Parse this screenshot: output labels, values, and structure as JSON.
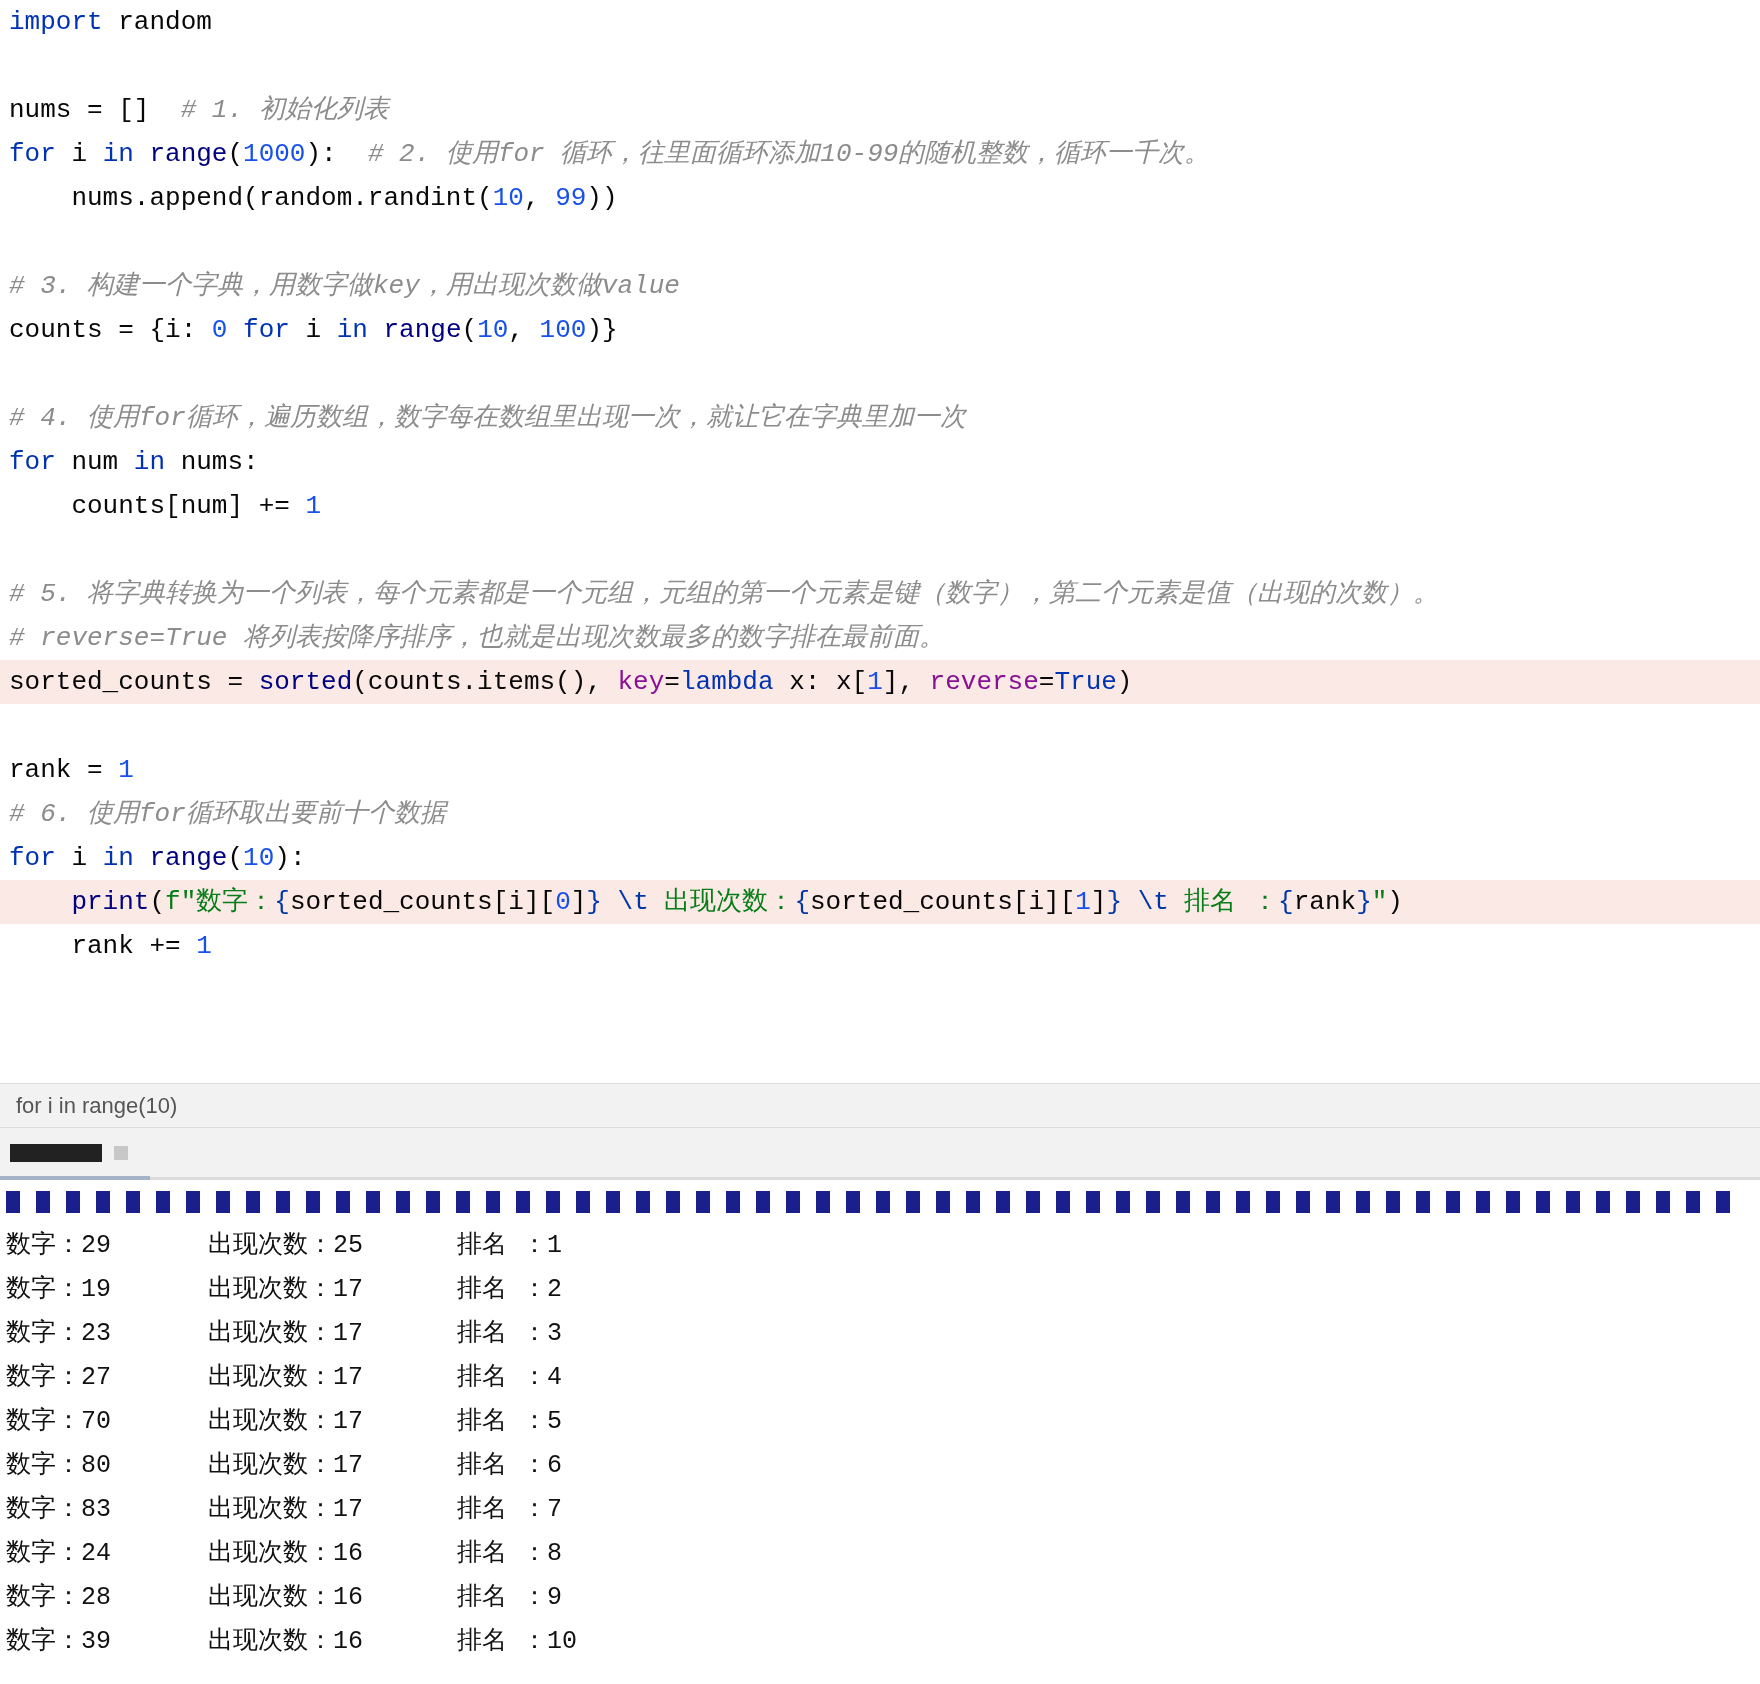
{
  "editor": {
    "lines": [
      {
        "kind": "code",
        "highlighted": false,
        "tokens": [
          {
            "kind": "kw",
            "text": "import"
          },
          {
            "kind": "plain",
            "text": " random"
          }
        ]
      },
      {
        "kind": "blank",
        "highlighted": false
      },
      {
        "kind": "code",
        "highlighted": false,
        "tokens": [
          {
            "kind": "plain",
            "text": "nums = []  "
          },
          {
            "kind": "comment",
            "text": "# 1. 初始化列表"
          }
        ]
      },
      {
        "kind": "code",
        "highlighted": false,
        "tokens": [
          {
            "kind": "kw",
            "text": "for"
          },
          {
            "kind": "plain",
            "text": " i "
          },
          {
            "kind": "kw",
            "text": "in "
          },
          {
            "kind": "builtin",
            "text": "range"
          },
          {
            "kind": "plain",
            "text": "("
          },
          {
            "kind": "num",
            "text": "1000"
          },
          {
            "kind": "plain",
            "text": "):  "
          },
          {
            "kind": "comment",
            "text": "# 2. 使用for 循环，往里面循环添加10-99的随机整数，循环一千次。"
          }
        ]
      },
      {
        "kind": "code",
        "highlighted": false,
        "tokens": [
          {
            "kind": "plain",
            "text": "    nums.append(random.randint("
          },
          {
            "kind": "num",
            "text": "10"
          },
          {
            "kind": "plain",
            "text": ", "
          },
          {
            "kind": "num",
            "text": "99"
          },
          {
            "kind": "plain",
            "text": "))"
          }
        ]
      },
      {
        "kind": "blank",
        "highlighted": false
      },
      {
        "kind": "code",
        "highlighted": false,
        "tokens": [
          {
            "kind": "comment",
            "text": "# 3. 构建一个字典，用数字做key，用出现次数做value"
          }
        ]
      },
      {
        "kind": "code",
        "highlighted": false,
        "tokens": [
          {
            "kind": "plain",
            "text": "counts = {i: "
          },
          {
            "kind": "num",
            "text": "0"
          },
          {
            "kind": "kw",
            "text": " for"
          },
          {
            "kind": "plain",
            "text": " i "
          },
          {
            "kind": "kw",
            "text": "in "
          },
          {
            "kind": "builtin",
            "text": "range"
          },
          {
            "kind": "plain",
            "text": "("
          },
          {
            "kind": "num",
            "text": "10"
          },
          {
            "kind": "plain",
            "text": ", "
          },
          {
            "kind": "num",
            "text": "100"
          },
          {
            "kind": "plain",
            "text": ")}"
          }
        ]
      },
      {
        "kind": "blank",
        "highlighted": false
      },
      {
        "kind": "code",
        "highlighted": false,
        "tokens": [
          {
            "kind": "comment",
            "text": "# 4. 使用for循环，遍历数组，数字每在数组里出现一次，就让它在字典里加一次"
          }
        ]
      },
      {
        "kind": "code",
        "highlighted": false,
        "tokens": [
          {
            "kind": "kw",
            "text": "for"
          },
          {
            "kind": "plain",
            "text": " num "
          },
          {
            "kind": "kw",
            "text": "in"
          },
          {
            "kind": "plain",
            "text": " nums:"
          }
        ]
      },
      {
        "kind": "code",
        "highlighted": false,
        "tokens": [
          {
            "kind": "plain",
            "text": "    counts[num] += "
          },
          {
            "kind": "num",
            "text": "1"
          }
        ]
      },
      {
        "kind": "blank",
        "highlighted": false
      },
      {
        "kind": "code",
        "highlighted": false,
        "tokens": [
          {
            "kind": "comment",
            "text": "# 5. 将字典转换为一个列表，每个元素都是一个元组，元组的第一个元素是键（数字），第二个元素是值（出现的次数）。"
          }
        ]
      },
      {
        "kind": "code",
        "highlighted": false,
        "tokens": [
          {
            "kind": "comment",
            "text": "# reverse=True 将列表按降序排序，也就是出现次数最多的数字排在最前面。"
          }
        ]
      },
      {
        "kind": "code",
        "highlighted": true,
        "tokens": [
          {
            "kind": "plain",
            "text": "sorted_counts = "
          },
          {
            "kind": "builtin",
            "text": "sorted"
          },
          {
            "kind": "plain",
            "text": "(counts.items(), "
          },
          {
            "kind": "param",
            "text": "key"
          },
          {
            "kind": "plain",
            "text": "="
          },
          {
            "kind": "kw",
            "text": "lambda"
          },
          {
            "kind": "plain",
            "text": " x: x["
          },
          {
            "kind": "num",
            "text": "1"
          },
          {
            "kind": "plain",
            "text": "], "
          },
          {
            "kind": "param",
            "text": "reverse"
          },
          {
            "kind": "plain",
            "text": "="
          },
          {
            "kind": "kw",
            "text": "True"
          },
          {
            "kind": "plain",
            "text": ")"
          }
        ]
      },
      {
        "kind": "blank",
        "highlighted": false
      },
      {
        "kind": "code",
        "highlighted": false,
        "tokens": [
          {
            "kind": "plain",
            "text": "rank = "
          },
          {
            "kind": "num",
            "text": "1"
          }
        ]
      },
      {
        "kind": "code",
        "highlighted": false,
        "tokens": [
          {
            "kind": "comment",
            "text": "# 6. 使用for循环取出要前十个数据"
          }
        ]
      },
      {
        "kind": "code",
        "highlighted": false,
        "tokens": [
          {
            "kind": "kw",
            "text": "for"
          },
          {
            "kind": "plain",
            "text": " i "
          },
          {
            "kind": "kw",
            "text": "in "
          },
          {
            "kind": "builtin",
            "text": "range"
          },
          {
            "kind": "plain",
            "text": "("
          },
          {
            "kind": "num",
            "text": "10"
          },
          {
            "kind": "plain",
            "text": "):"
          }
        ]
      },
      {
        "kind": "code",
        "highlighted": true,
        "tokens": [
          {
            "kind": "builtin",
            "text": "    print"
          },
          {
            "kind": "plain",
            "text": "("
          },
          {
            "kind": "string",
            "text": "f\"数字："
          },
          {
            "kind": "escape",
            "text": "{"
          },
          {
            "kind": "plain",
            "text": "sorted_counts[i]["
          },
          {
            "kind": "num",
            "text": "0"
          },
          {
            "kind": "plain",
            "text": "]"
          },
          {
            "kind": "escape",
            "text": "}"
          },
          {
            "kind": "escape",
            "text": " \\t"
          },
          {
            "kind": "string",
            "text": " 出现次数："
          },
          {
            "kind": "escape",
            "text": "{"
          },
          {
            "kind": "plain",
            "text": "sorted_counts[i]["
          },
          {
            "kind": "num",
            "text": "1"
          },
          {
            "kind": "plain",
            "text": "]"
          },
          {
            "kind": "escape",
            "text": "}"
          },
          {
            "kind": "escape",
            "text": " \\t"
          },
          {
            "kind": "string",
            "text": " 排名 ："
          },
          {
            "kind": "escape",
            "text": "{"
          },
          {
            "kind": "plain",
            "text": "rank"
          },
          {
            "kind": "escape",
            "text": "}"
          },
          {
            "kind": "string",
            "text": "\""
          },
          {
            "kind": "plain",
            "text": ")"
          }
        ]
      },
      {
        "kind": "code",
        "highlighted": false,
        "tokens": [
          {
            "kind": "plain",
            "text": "    rank += "
          },
          {
            "kind": "num",
            "text": "1"
          }
        ]
      }
    ]
  },
  "breadcrumb": "for i in range(10)",
  "output": [
    {
      "number": "数字：29",
      "count": "出现次数：25",
      "rank": "排名 ：1"
    },
    {
      "number": "数字：19",
      "count": "出现次数：17",
      "rank": "排名 ：2"
    },
    {
      "number": "数字：23",
      "count": "出现次数：17",
      "rank": "排名 ：3"
    },
    {
      "number": "数字：27",
      "count": "出现次数：17",
      "rank": "排名 ：4"
    },
    {
      "number": "数字：70",
      "count": "出现次数：17",
      "rank": "排名 ：5"
    },
    {
      "number": "数字：80",
      "count": "出现次数：17",
      "rank": "排名 ：6"
    },
    {
      "number": "数字：83",
      "count": "出现次数：17",
      "rank": "排名 ：7"
    },
    {
      "number": "数字：24",
      "count": "出现次数：16",
      "rank": "排名 ：8"
    },
    {
      "number": "数字：28",
      "count": "出现次数：16",
      "rank": "排名 ：9"
    },
    {
      "number": "数字：39",
      "count": "出现次数：16",
      "rank": "排名 ：10"
    }
  ]
}
